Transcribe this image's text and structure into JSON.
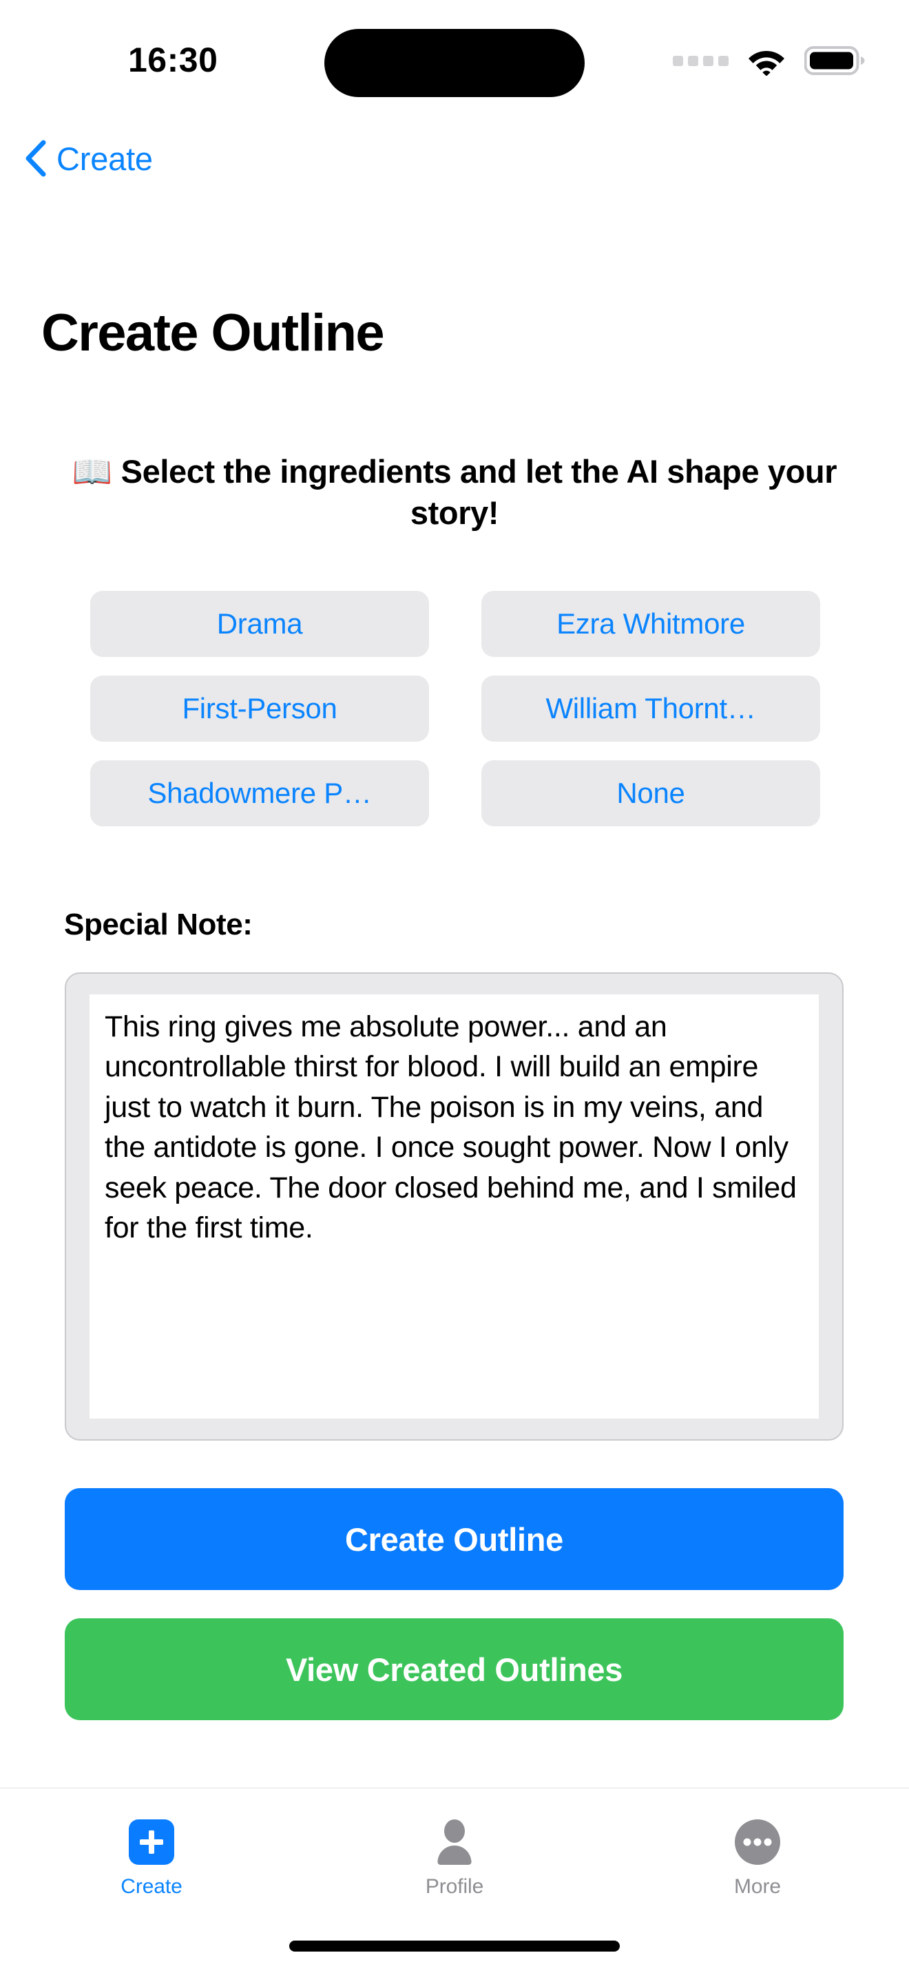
{
  "status_bar": {
    "time": "16:30",
    "signal_icon": "signal-dots-icon",
    "wifi_icon": "wifi-icon",
    "battery_icon": "battery-full-icon"
  },
  "nav": {
    "back_icon": "chevron-left-icon",
    "back_label": "Create"
  },
  "header": {
    "title": "Create Outline"
  },
  "main": {
    "subtitle": "📖 Select the ingredients and let the AI shape your story!",
    "chips": [
      {
        "label": "Drama",
        "name": "chip-genre"
      },
      {
        "label": "Ezra Whitmore",
        "name": "chip-protagonist"
      },
      {
        "label": "First-Person",
        "name": "chip-narrative-perspective"
      },
      {
        "label": "William Thornt…",
        "name": "chip-antagonist"
      },
      {
        "label": "Shadowmere P…",
        "name": "chip-setting"
      },
      {
        "label": "None",
        "name": "chip-extra"
      }
    ],
    "note": {
      "label": "Special Note:",
      "value": "This ring gives me absolute power... and an uncontrollable thirst for blood. I will build an empire just to watch it burn. The poison is in my veins, and the antidote is gone. I once sought power. Now I only seek peace. The door closed behind me, and I smiled for the first time.",
      "placeholder": "Special Note"
    },
    "primary_button": "Create Outline",
    "secondary_button": "View Created Outlines"
  },
  "tab_bar": {
    "tabs": [
      {
        "label": "Create",
        "icon": "plus-square-icon",
        "active": true
      },
      {
        "label": "Profile",
        "icon": "person-icon",
        "active": false
      },
      {
        "label": "More",
        "icon": "ellipsis-circle-icon",
        "active": false
      }
    ]
  },
  "colors": {
    "accent_blue": "#0a7cff",
    "link_blue": "#0a84ff",
    "success_green": "#3cc45b",
    "chip_bg": "#e9e9eb",
    "inactive_gray": "#8e8e93"
  }
}
